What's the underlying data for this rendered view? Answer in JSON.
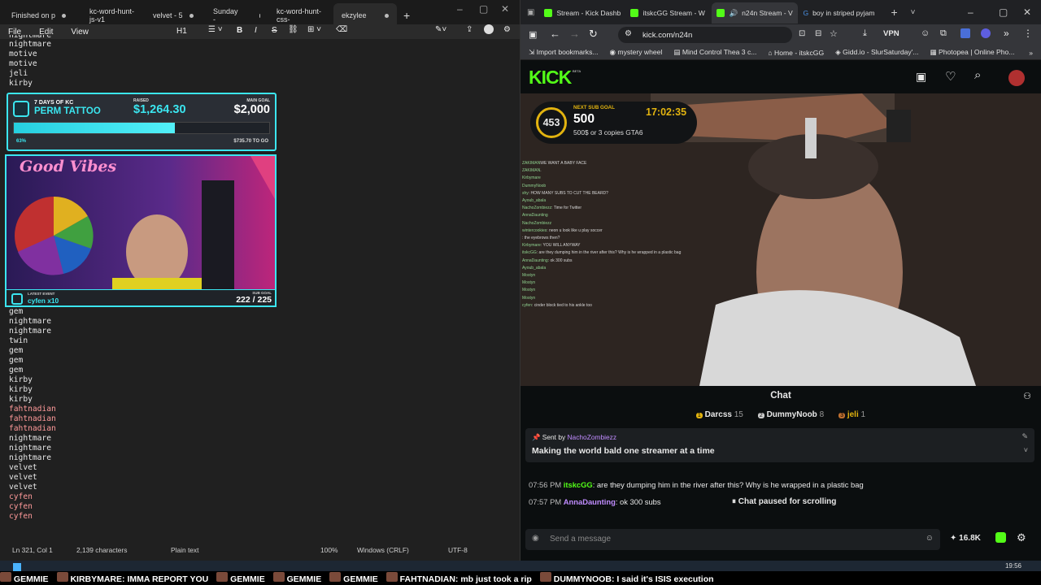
{
  "notepad": {
    "tabs": [
      "Finished on p",
      "kc-word-hunt-js-v1",
      "velvet - 5",
      "Sunday -",
      "kc-word-hunt-css-",
      "ekzylee"
    ],
    "menu": [
      "File",
      "Edit",
      "View"
    ],
    "heading_btn": "H1",
    "lines_top": [
      "nightmare",
      "nightmare",
      "motive",
      "motive",
      "jeli",
      "kirby"
    ],
    "lines": [
      {
        "t": "gem",
        "c": "n"
      },
      {
        "t": "nightmare",
        "c": "n"
      },
      {
        "t": "nightmare",
        "c": "n"
      },
      {
        "t": "twin",
        "c": "n"
      },
      {
        "t": "gem",
        "c": "n"
      },
      {
        "t": "gem",
        "c": "n"
      },
      {
        "t": "gem",
        "c": "n"
      },
      {
        "t": "kirby",
        "c": "n"
      },
      {
        "t": "kirby",
        "c": "n"
      },
      {
        "t": "kirby",
        "c": "n"
      },
      {
        "t": "fahtnadian",
        "c": "red"
      },
      {
        "t": "fahtnadian",
        "c": "red"
      },
      {
        "t": "fahtnadian",
        "c": "red"
      },
      {
        "t": "nightmare",
        "c": "n"
      },
      {
        "t": "nightmare",
        "c": "n"
      },
      {
        "t": "nightmare",
        "c": "n"
      },
      {
        "t": "velvet",
        "c": "n"
      },
      {
        "t": "velvet",
        "c": "n"
      },
      {
        "t": "velvet",
        "c": "n"
      },
      {
        "t": "cyfen",
        "c": "red"
      },
      {
        "t": "cyfen",
        "c": "red"
      },
      {
        "t": "cyfen",
        "c": "red"
      }
    ],
    "status": {
      "pos": "Ln 321, Col 1",
      "chars": "2,139 characters",
      "mode": "Plain text",
      "zoom": "100%",
      "eol": "Windows (CRLF)",
      "enc": "UTF-8"
    }
  },
  "goal_overlay": {
    "kicker": "7 DAYS OF KC",
    "title": "PERM TATTOO",
    "raised_label": "RAISED",
    "raised": "$1,264.30",
    "main_label": "MAIN GOAL",
    "main": "$2,000",
    "percent_text": "63%",
    "progress": 0.63,
    "remaining": "$735.70 TO GO"
  },
  "cam_overlay": {
    "sign": "Good Vibes",
    "latest_label": "LATEST EVENT",
    "latest": "cyfen x10",
    "sub_label": "SUB GOAL",
    "sub": "222 / 225"
  },
  "browser": {
    "tabs": [
      "Stream - Kick Dashb",
      "itskcGG Stream - W",
      "n24n Stream - V",
      "boy in striped pyjam"
    ],
    "url": "kick.com/n24n",
    "vpn": "VPN",
    "bookmarks": [
      "Import bookmarks...",
      "mystery wheel",
      "Mind Control Thea 3 c...",
      "Home - itskcGG",
      "Gidd.io - SlurSaturday'...",
      "Photopea | Online Pho..."
    ]
  },
  "kick": {
    "logo": "KICK",
    "logo_badge": "BETA",
    "sub_goal": {
      "count": "453",
      "label": "NEXT SUB GOAL",
      "value": "500",
      "time": "17:02:35",
      "desc": "500$ or 3 copies GTA6"
    },
    "stream_chat": [
      [
        "ZAKIMAN",
        "WE WANT A BABY FACE"
      ],
      [
        "ZAKIMAN",
        "."
      ],
      [
        "Kirbymare",
        ""
      ],
      [
        "DummyNoob",
        ""
      ],
      [
        "shy",
        ": HOW MANY SUBS TO CUT THE BEARD?"
      ],
      [
        "Ayoub_abala",
        ""
      ],
      [
        "NachoZombiezz",
        ": Time for Twitter"
      ],
      [
        "AnnaDaunting",
        ""
      ],
      [
        "NachoZombiezz",
        ""
      ],
      [
        "wintercookies",
        ": neon u look like u play soccer"
      ],
      [
        "",
        ": the eyebrows then?"
      ],
      [
        "Kirbymare",
        ": YOU WILL ANYWAY"
      ],
      [
        "itskcGG",
        ": are they dumping him in the river after this? Why is he wrapped in a plastic bag"
      ],
      [
        "AnnaDaunting",
        ": ok 300 subs"
      ],
      [
        "Ayoub_abala",
        ""
      ],
      [
        "Mostyn",
        ""
      ],
      [
        "Mostyn",
        ""
      ],
      [
        "Mostyn",
        ""
      ],
      [
        "Mostyn",
        ""
      ],
      [
        "cyfen",
        ": cinder block tied to his ankle too"
      ]
    ],
    "chat_title": "Chat",
    "leaders": [
      {
        "rank": "1",
        "name": "Darcss",
        "n": "15"
      },
      {
        "rank": "2",
        "name": "DummyNoob",
        "n": "8"
      },
      {
        "rank": "3",
        "name": "jeli",
        "n": "1"
      }
    ],
    "pinned": {
      "label": "Sent by",
      "by": "NachoZombiezz",
      "msg": "Making the world bald one streamer at a time"
    },
    "messages": [
      {
        "time": "07:56 PM",
        "user": "itskcGG",
        "text": ": are they dumping him in the river after this? Why is he wrapped in a plastic bag",
        "color": "#53fc18"
      },
      {
        "time": "07:57 PM",
        "user": "AnnaDaunting",
        "text": ": ok 300 subs",
        "color": "#c08cff"
      }
    ],
    "paused": "Chat paused for scrolling",
    "input_placeholder": "Send a message",
    "viewers": "16.8K"
  },
  "taskbar": {
    "ticker": [
      {
        "name": "GEMMIE",
        "msg": ""
      },
      {
        "name": "KIRBYMARE",
        "msg": ": IMMA REPORT YOU"
      },
      {
        "name": "GEMMIE",
        "msg": ""
      },
      {
        "name": "GEMMIE",
        "msg": ""
      },
      {
        "name": "GEMMIE",
        "msg": ""
      },
      {
        "name": "FAHTNADIAN",
        "msg": ": mb just took a rip"
      },
      {
        "name": "DUMMYNOOB",
        "msg": ": I said it's ISIS execution"
      }
    ],
    "clock": "19:56"
  },
  "colors": {
    "kick_green": "#53fc18",
    "cyan": "#3be6f0"
  }
}
